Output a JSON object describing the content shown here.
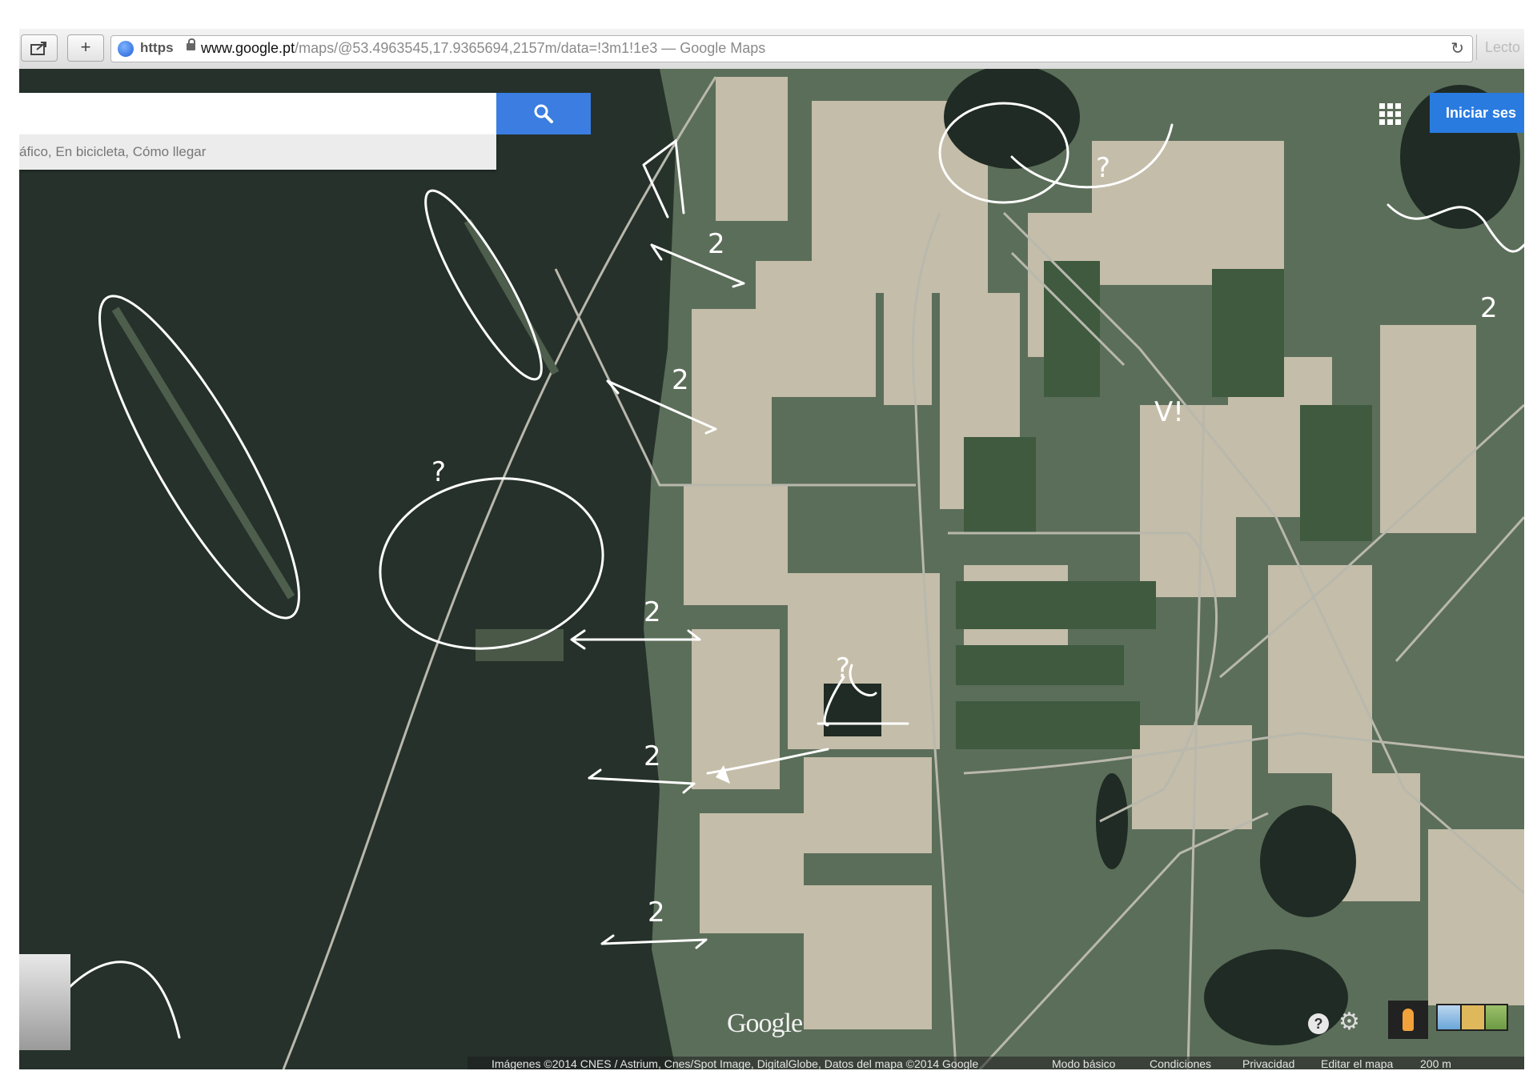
{
  "browser": {
    "scheme": "https",
    "url_host": "www.google.pt",
    "url_path": "/maps/@53.4963545,17.9365694,2157m/data=!3m1!1e3 — Google Maps",
    "reader_label": "Lecto",
    "share_icon": "share-icon",
    "add_icon": "plus-icon",
    "reload_icon": "reload-icon"
  },
  "search": {
    "query": "",
    "subbar_text": "áfico, En bicicleta, Cómo llegar"
  },
  "header": {
    "signin_label": "Iniciar ses"
  },
  "map": {
    "view": "satellite",
    "logo": "Google",
    "help_label": "?",
    "attribution": "Imágenes ©2014 CNES / Astrium, Cnes/Spot Image, DigitalGlobe, Datos del mapa ©2014 Google",
    "links": [
      "Modo básico",
      "Condiciones",
      "Privacidad",
      "Editar el mapa"
    ],
    "scale_label": "200 m"
  },
  "annotations": {
    "marks": [
      "?",
      "2",
      "2",
      "2",
      "2",
      "2",
      "?",
      "V!",
      "?",
      "2"
    ]
  },
  "colors": {
    "forest": "#26332a",
    "field_light": "#c9c2ae",
    "field_green": "#4f6b4c",
    "search_blue": "#3b7de0",
    "annotation": "#ffffff"
  }
}
